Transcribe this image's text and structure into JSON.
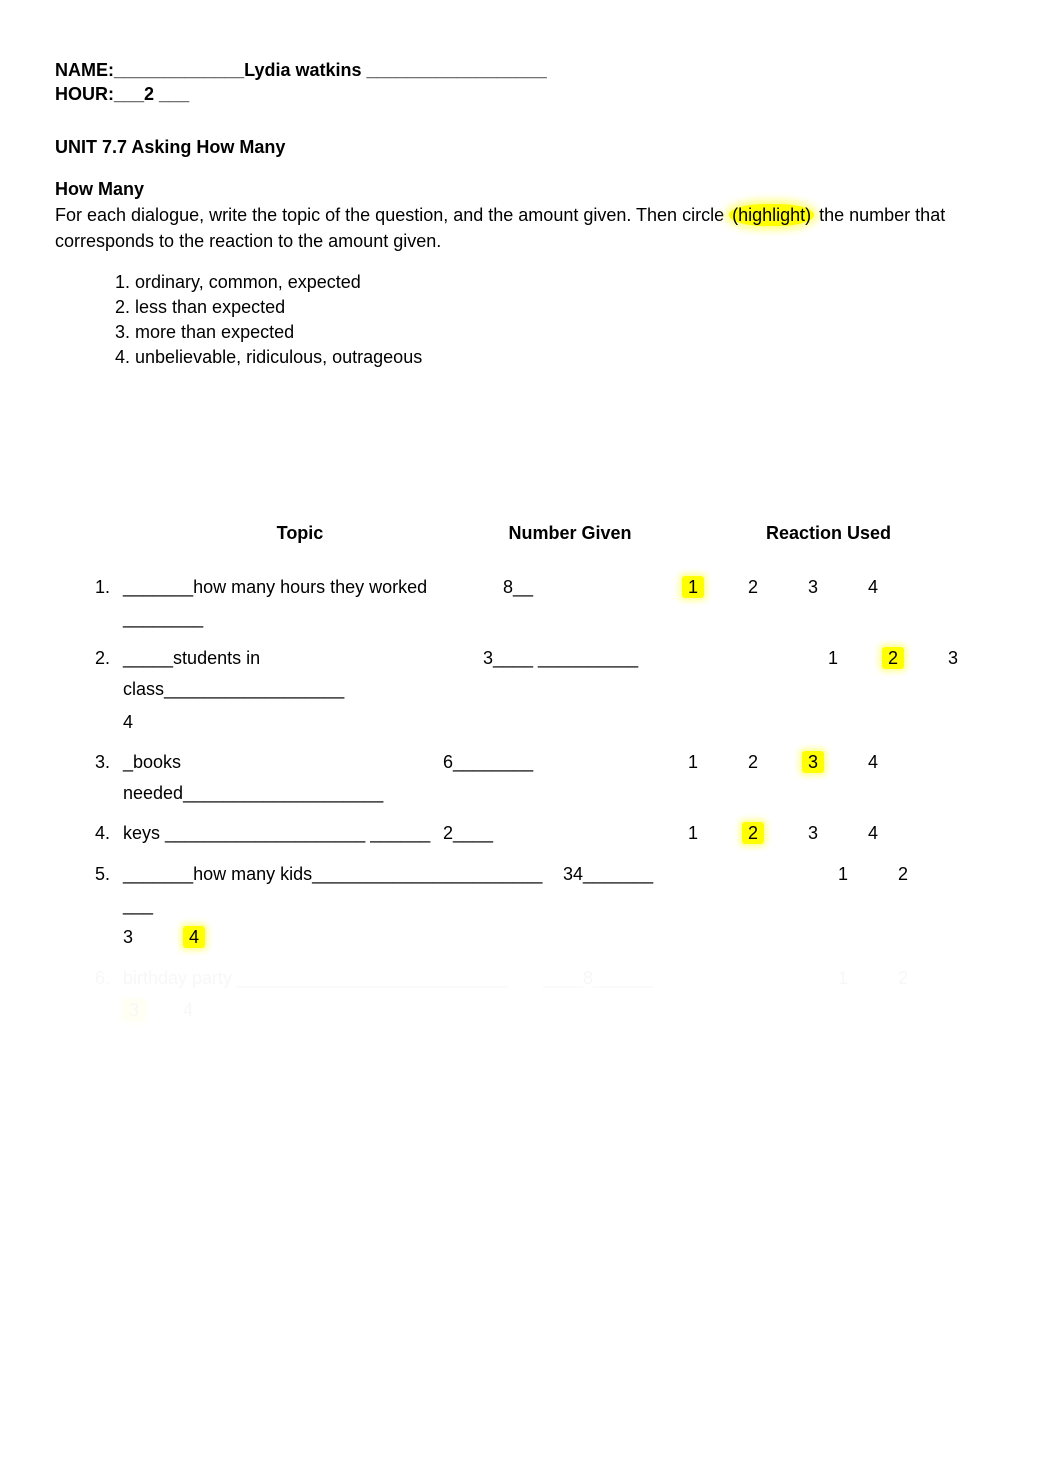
{
  "header": {
    "name_label": "NAME:",
    "name_value": "_____________Lydia watkins __________________",
    "hour_label": "HOUR:",
    "hour_value": "___2 ___"
  },
  "unit_title": "UNIT  7.7  Asking How Many",
  "section": {
    "title": "How Many",
    "instructions_pre": "For each dialogue, write the topic of the question, and the amount given.  Then circle ",
    "highlight_word": "(highlight)",
    "instructions_post": "  the number that corresponds to the reaction to the amount given."
  },
  "legend": [
    "1.  ordinary, common, expected",
    "2.  less than expected",
    "3.  more than expected",
    "4.  unbelievable, ridiculous, outrageous"
  ],
  "columns": {
    "topic": "Topic",
    "number": "Number Given",
    "reaction": "Reaction Used"
  },
  "rows": [
    {
      "num": "1.",
      "topic": "_______how many hours they worked ________",
      "given": "8__",
      "reactions": [
        "1",
        "2",
        "3",
        "4"
      ],
      "highlighted_index": 0,
      "wrap": null,
      "topic_w": 380,
      "given_w": 110,
      "gap": 50
    },
    {
      "num": "2.",
      "topic": "_____students in class__________________",
      "given": "3____   __________",
      "reactions": [
        "1",
        "2",
        "3"
      ],
      "highlighted_index": 1,
      "wrap": "4",
      "wrap_hl": null,
      "topic_w": 360,
      "given_w": 230,
      "gap": 90
    },
    {
      "num": "3.",
      "topic": "_books needed____________________ ",
      "given": "6________",
      "reactions": [
        "1",
        "2",
        "3",
        "4"
      ],
      "highlighted_index": 2,
      "wrap": null,
      "topic_w": 320,
      "given_w": 170,
      "gap": 50
    },
    {
      "num": "4.",
      "topic": "keys ____________________   ______",
      "given": "2____",
      "reactions": [
        "1",
        "2",
        "3",
        "4"
      ],
      "highlighted_index": 1,
      "wrap": null,
      "topic_w": 320,
      "given_w": 170,
      "gap": 50
    },
    {
      "num": "5.",
      "topic": "_______how many kids_______________________ ___",
      "given": "34_______",
      "reactions": [
        "1",
        "2"
      ],
      "highlighted_index": null,
      "wrap": "3        4",
      "wrap_hl": 1,
      "topic_w": 440,
      "given_w": 150,
      "gap": 100
    },
    {
      "num": "6.",
      "topic": "birthday party ___________________________",
      "given": "____8______",
      "reactions": [
        "1",
        "2"
      ],
      "highlighted_index": null,
      "wrap": "3     4",
      "wrap_hl": 0,
      "topic_w": 420,
      "given_w": 170,
      "gap": 100,
      "faded": true
    }
  ]
}
